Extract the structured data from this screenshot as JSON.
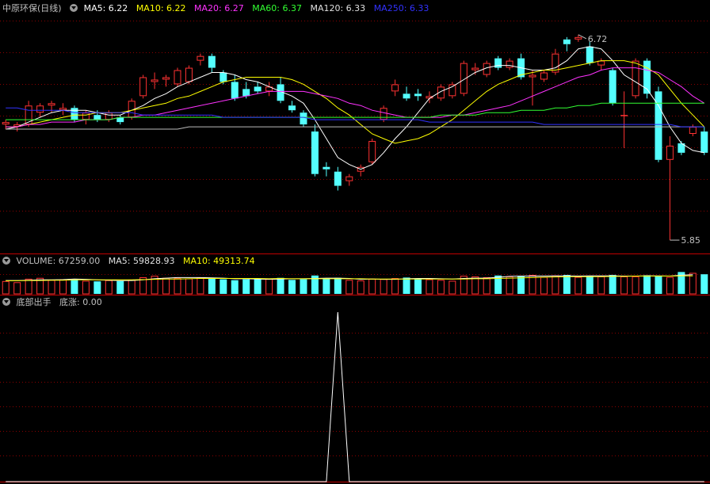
{
  "colors": {
    "up": "#ff3232",
    "down": "#54ffff",
    "ma5": "#ffffff",
    "ma10": "#ffff00",
    "ma20": "#ff32ff",
    "ma60": "#32ff32",
    "ma120": "#ffffff",
    "ma250": "#3232ff",
    "grid": "#8a0000",
    "divider": "#c00000",
    "text": "#c0c0c0"
  },
  "main_header": {
    "title": "中原环保(日线)",
    "ma5": "MA5: 6.22",
    "ma10": "MA10: 6.22",
    "ma20": "MA20: 6.27",
    "ma60": "MA60: 6.37",
    "ma120": "MA120: 6.33",
    "ma250": "MA250: 6.33"
  },
  "volume_header": {
    "label": "VOLUME: 67259.00",
    "ma5": "MA5: 59828.93",
    "ma10": "MA10: 49313.74"
  },
  "indicator_header": {
    "label": "底部出手",
    "value": "底涨: 0.00"
  },
  "annotations": {
    "high": "6.72",
    "low": "5.85"
  },
  "chart_data": [
    {
      "type": "candlestick",
      "series": [
        {
          "name": "K",
          "ohlc": [
            [
              6.34,
              6.36,
              6.32,
              6.35
            ],
            [
              6.33,
              6.35,
              6.31,
              6.34
            ],
            [
              6.34,
              6.44,
              6.33,
              6.42
            ],
            [
              6.39,
              6.43,
              6.37,
              6.42
            ],
            [
              6.42,
              6.44,
              6.39,
              6.43
            ],
            [
              6.4,
              6.43,
              6.38,
              6.41
            ],
            [
              6.41,
              6.42,
              6.35,
              6.36
            ],
            [
              6.36,
              6.4,
              6.34,
              6.39
            ],
            [
              6.38,
              6.4,
              6.35,
              6.36
            ],
            [
              6.36,
              6.4,
              6.35,
              6.39
            ],
            [
              6.37,
              6.38,
              6.34,
              6.35
            ],
            [
              6.37,
              6.45,
              6.36,
              6.44
            ],
            [
              6.46,
              6.55,
              6.45,
              6.54
            ],
            [
              6.52,
              6.56,
              6.49,
              6.53
            ],
            [
              6.53,
              6.55,
              6.5,
              6.54
            ],
            [
              6.51,
              6.58,
              6.5,
              6.57
            ],
            [
              6.52,
              6.59,
              6.51,
              6.58
            ],
            [
              6.61,
              6.64,
              6.59,
              6.63
            ],
            [
              6.63,
              6.64,
              6.56,
              6.58
            ],
            [
              6.56,
              6.57,
              6.51,
              6.52
            ],
            [
              6.52,
              6.55,
              6.44,
              6.45
            ],
            [
              6.49,
              6.52,
              6.45,
              6.46
            ],
            [
              6.5,
              6.52,
              6.47,
              6.48
            ],
            [
              6.48,
              6.52,
              6.46,
              6.5
            ],
            [
              6.51,
              6.54,
              6.43,
              6.44
            ],
            [
              6.42,
              6.44,
              6.39,
              6.4
            ],
            [
              6.39,
              6.4,
              6.33,
              6.34
            ],
            [
              6.31,
              6.34,
              6.12,
              6.13
            ],
            [
              6.16,
              6.18,
              6.12,
              6.15
            ],
            [
              6.14,
              6.16,
              6.06,
              6.08
            ],
            [
              6.1,
              6.13,
              6.08,
              6.12
            ],
            [
              6.14,
              6.17,
              6.12,
              6.16
            ],
            [
              6.18,
              6.28,
              6.17,
              6.27
            ],
            [
              6.36,
              6.42,
              6.35,
              6.41
            ],
            [
              6.48,
              6.53,
              6.46,
              6.51
            ],
            [
              6.47,
              6.5,
              6.44,
              6.45
            ],
            [
              6.47,
              6.49,
              6.44,
              6.46
            ],
            [
              6.45,
              6.48,
              6.43,
              6.46
            ],
            [
              6.45,
              6.51,
              6.44,
              6.5
            ],
            [
              6.46,
              6.52,
              6.45,
              6.51
            ],
            [
              6.47,
              6.61,
              6.46,
              6.6
            ],
            [
              6.57,
              6.6,
              6.55,
              6.58
            ],
            [
              6.55,
              6.61,
              6.54,
              6.6
            ],
            [
              6.62,
              6.63,
              6.57,
              6.58
            ],
            [
              6.58,
              6.62,
              6.57,
              6.61
            ],
            [
              6.62,
              6.64,
              6.53,
              6.54
            ],
            [
              6.54,
              6.57,
              6.42,
              6.55
            ],
            [
              6.53,
              6.57,
              6.52,
              6.56
            ],
            [
              6.56,
              6.66,
              6.55,
              6.64
            ],
            [
              6.7,
              6.71,
              6.65,
              6.68
            ],
            [
              6.7,
              6.72,
              6.69,
              6.71
            ],
            [
              6.67,
              6.69,
              6.59,
              6.6
            ],
            [
              6.59,
              6.62,
              6.57,
              6.61
            ],
            [
              6.57,
              6.58,
              6.42,
              6.43
            ],
            [
              6.38,
              6.48,
              6.24,
              6.38
            ],
            [
              6.46,
              6.62,
              6.45,
              6.61
            ],
            [
              6.61,
              6.62,
              6.45,
              6.47
            ],
            [
              6.48,
              6.5,
              6.18,
              6.19
            ],
            [
              6.19,
              6.29,
              5.85,
              6.25
            ],
            [
              6.26,
              6.27,
              6.21,
              6.22
            ],
            [
              6.3,
              6.34,
              6.29,
              6.33
            ],
            [
              6.31,
              6.33,
              6.21,
              6.22
            ]
          ]
        },
        {
          "name": "MA5",
          "values": [
            6.32,
            6.33,
            6.35,
            6.37,
            6.39,
            6.4,
            6.4,
            6.4,
            6.39,
            6.38,
            6.38,
            6.4,
            6.42,
            6.45,
            6.47,
            6.5,
            6.52,
            6.54,
            6.56,
            6.56,
            6.55,
            6.53,
            6.52,
            6.5,
            6.48,
            6.46,
            6.43,
            6.36,
            6.28,
            6.2,
            6.17,
            6.15,
            6.17,
            6.22,
            6.28,
            6.33,
            6.39,
            6.45,
            6.48,
            6.5,
            6.53,
            6.56,
            6.58,
            6.59,
            6.59,
            6.58,
            6.57,
            6.57,
            6.58,
            6.61,
            6.66,
            6.67,
            6.66,
            6.61,
            6.55,
            6.52,
            6.49,
            6.42,
            6.33,
            6.26,
            6.23,
            6.22
          ]
        },
        {
          "name": "MA10",
          "values": [
            6.33,
            6.33,
            6.34,
            6.35,
            6.36,
            6.37,
            6.38,
            6.38,
            6.39,
            6.39,
            6.39,
            6.4,
            6.41,
            6.42,
            6.43,
            6.45,
            6.46,
            6.48,
            6.5,
            6.52,
            6.53,
            6.54,
            6.54,
            6.54,
            6.54,
            6.53,
            6.51,
            6.48,
            6.45,
            6.41,
            6.38,
            6.34,
            6.3,
            6.28,
            6.26,
            6.27,
            6.28,
            6.3,
            6.33,
            6.36,
            6.4,
            6.44,
            6.48,
            6.51,
            6.53,
            6.55,
            6.56,
            6.57,
            6.57,
            6.58,
            6.59,
            6.6,
            6.61,
            6.61,
            6.61,
            6.6,
            6.58,
            6.55,
            6.49,
            6.43,
            6.38,
            6.33
          ]
        },
        {
          "name": "MA20",
          "values": [
            6.33,
            6.33,
            6.34,
            6.34,
            6.35,
            6.35,
            6.35,
            6.36,
            6.36,
            6.36,
            6.37,
            6.37,
            6.38,
            6.38,
            6.39,
            6.4,
            6.41,
            6.42,
            6.43,
            6.44,
            6.45,
            6.46,
            6.47,
            6.48,
            6.48,
            6.48,
            6.48,
            6.47,
            6.46,
            6.45,
            6.43,
            6.42,
            6.4,
            6.39,
            6.38,
            6.37,
            6.37,
            6.37,
            6.37,
            6.38,
            6.38,
            6.39,
            6.4,
            6.41,
            6.42,
            6.44,
            6.46,
            6.48,
            6.5,
            6.52,
            6.54,
            6.55,
            6.57,
            6.58,
            6.58,
            6.58,
            6.57,
            6.56,
            6.53,
            6.5,
            6.46,
            6.43
          ]
        },
        {
          "name": "MA60",
          "values": [
            6.36,
            6.36,
            6.36,
            6.36,
            6.36,
            6.36,
            6.36,
            6.36,
            6.36,
            6.36,
            6.37,
            6.37,
            6.37,
            6.37,
            6.37,
            6.37,
            6.37,
            6.37,
            6.37,
            6.37,
            6.37,
            6.37,
            6.37,
            6.37,
            6.37,
            6.37,
            6.37,
            6.37,
            6.37,
            6.37,
            6.37,
            6.37,
            6.37,
            6.37,
            6.37,
            6.37,
            6.37,
            6.37,
            6.38,
            6.38,
            6.38,
            6.38,
            6.39,
            6.39,
            6.39,
            6.4,
            6.4,
            6.4,
            6.41,
            6.41,
            6.42,
            6.42,
            6.43,
            6.43,
            6.43,
            6.43,
            6.43,
            6.43,
            6.43,
            6.43,
            6.43,
            6.43
          ]
        },
        {
          "name": "MA120",
          "values": [
            6.32,
            6.32,
            6.32,
            6.32,
            6.32,
            6.32,
            6.32,
            6.32,
            6.32,
            6.32,
            6.32,
            6.32,
            6.32,
            6.32,
            6.32,
            6.32,
            6.33,
            6.33,
            6.33,
            6.33,
            6.33,
            6.33,
            6.33,
            6.33,
            6.33,
            6.33,
            6.33,
            6.33,
            6.33,
            6.33,
            6.33,
            6.33,
            6.33,
            6.33,
            6.33,
            6.33,
            6.33,
            6.33,
            6.33,
            6.33,
            6.33,
            6.33,
            6.33,
            6.33,
            6.33,
            6.33,
            6.33,
            6.33,
            6.33,
            6.33,
            6.33,
            6.33,
            6.33,
            6.33,
            6.33,
            6.33,
            6.33,
            6.33,
            6.33,
            6.33,
            6.33,
            6.33
          ]
        },
        {
          "name": "MA250",
          "values": [
            6.41,
            6.41,
            6.4,
            6.4,
            6.4,
            6.4,
            6.39,
            6.39,
            6.39,
            6.39,
            6.39,
            6.39,
            6.38,
            6.38,
            6.38,
            6.38,
            6.38,
            6.38,
            6.38,
            6.37,
            6.37,
            6.37,
            6.37,
            6.37,
            6.37,
            6.37,
            6.37,
            6.36,
            6.36,
            6.36,
            6.36,
            6.36,
            6.36,
            6.36,
            6.36,
            6.36,
            6.36,
            6.35,
            6.35,
            6.35,
            6.35,
            6.35,
            6.35,
            6.35,
            6.35,
            6.35,
            6.35,
            6.34,
            6.34,
            6.34,
            6.34,
            6.34,
            6.34,
            6.34,
            6.34,
            6.34,
            6.34,
            6.34,
            6.34,
            6.33,
            6.33,
            6.33
          ]
        }
      ],
      "ylim": [
        5.8,
        6.8
      ]
    },
    {
      "type": "bar",
      "series": [
        {
          "name": "VOLUME",
          "values": [
            44000,
            40000,
            52000,
            55000,
            48000,
            50000,
            51000,
            45000,
            43000,
            47000,
            44000,
            49000,
            57000,
            62000,
            55000,
            54000,
            53000,
            57000,
            54000,
            50000,
            47000,
            50000,
            53000,
            52000,
            55000,
            48000,
            50000,
            63000,
            52000,
            55000,
            48000,
            46000,
            52000,
            51000,
            54000,
            56000,
            52000,
            50000,
            48000,
            45000,
            62000,
            60000,
            57000,
            63000,
            60000,
            62000,
            65000,
            58000,
            63000,
            65000,
            58000,
            62000,
            60000,
            65000,
            60000,
            60000,
            64000,
            61000,
            58000,
            75000,
            72000,
            67259
          ]
        },
        {
          "name": "MA5",
          "values": [
            46000,
            46000,
            47000,
            48000,
            48000,
            49000,
            51000,
            50000,
            48000,
            47000,
            46000,
            46000,
            48000,
            52000,
            54000,
            56000,
            56000,
            56000,
            55000,
            54000,
            52000,
            52000,
            51000,
            50000,
            51000,
            52000,
            52000,
            53000,
            54000,
            54000,
            53000,
            50000,
            51000,
            50000,
            50000,
            52000,
            53000,
            53000,
            52000,
            51000,
            53000,
            54000,
            54000,
            57000,
            60000,
            61000,
            61000,
            61000,
            62000,
            62000,
            61000,
            62000,
            62000,
            62000,
            61000,
            61000,
            62000,
            62000,
            61000,
            64000,
            66000,
            59829
          ]
        },
        {
          "name": "MA10",
          "values": [
            45000,
            45000,
            46000,
            46000,
            47000,
            47000,
            48000,
            48000,
            48000,
            48000,
            48000,
            48000,
            49000,
            50000,
            51000,
            51000,
            52000,
            53000,
            53000,
            53000,
            53000,
            53000,
            53000,
            52000,
            53000,
            52000,
            52000,
            52000,
            52000,
            52000,
            52000,
            52000,
            51000,
            51000,
            51000,
            51000,
            51000,
            51000,
            51000,
            51000,
            51000,
            52000,
            52000,
            53000,
            54000,
            55000,
            56000,
            57000,
            58000,
            59000,
            59000,
            59000,
            59000,
            60000,
            60000,
            61000,
            61000,
            61000,
            61000,
            62000,
            62000,
            49314
          ]
        }
      ]
    },
    {
      "type": "line",
      "series": [
        {
          "name": "底涨",
          "values": [
            0,
            0,
            0,
            0,
            0,
            0,
            0,
            0,
            0,
            0,
            0,
            0,
            0,
            0,
            0,
            0,
            0,
            0,
            0,
            0,
            0,
            0,
            0,
            0,
            0,
            0,
            0,
            0,
            0,
            1,
            0,
            0,
            0,
            0,
            0,
            0,
            0,
            0,
            0,
            0,
            0,
            0,
            0,
            0,
            0,
            0,
            0,
            0,
            0,
            0,
            0,
            0,
            0,
            0,
            0,
            0,
            0,
            0,
            0,
            0,
            0,
            0
          ]
        }
      ],
      "ylim": [
        0,
        1
      ]
    }
  ]
}
